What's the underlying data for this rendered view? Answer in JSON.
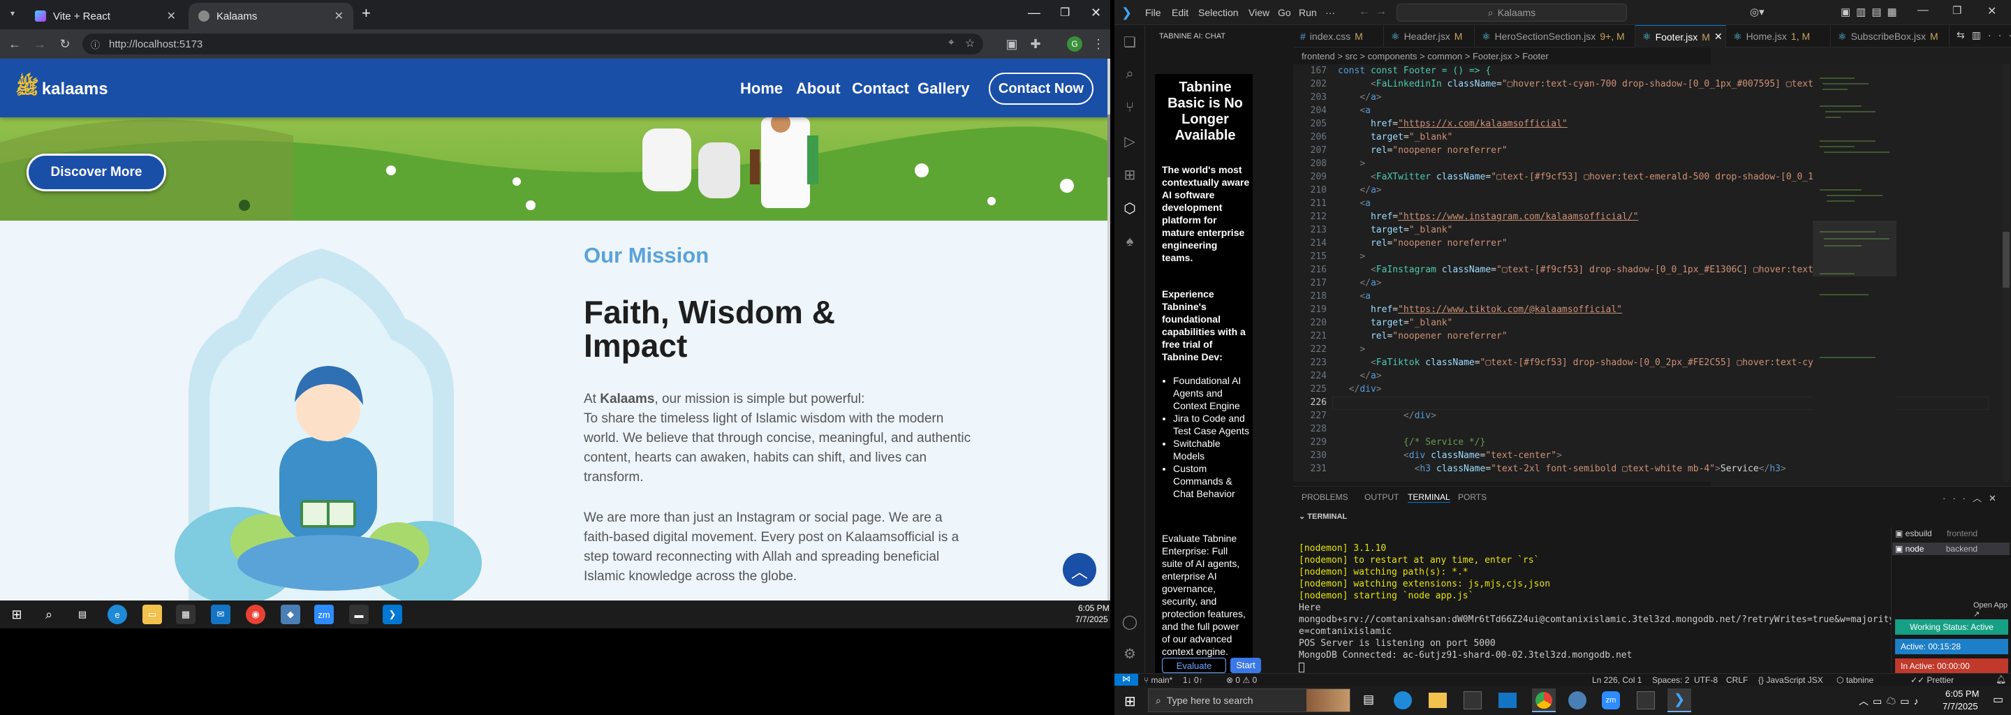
{
  "chrome": {
    "tabs": [
      {
        "label": "Vite + React"
      },
      {
        "label": "Kalaams"
      }
    ],
    "new_tab": "+",
    "url": "http://localhost:5173"
  },
  "site": {
    "logo": "kalaams",
    "nav": [
      {
        "label": "Home"
      },
      {
        "label": "About"
      },
      {
        "label": "Contact"
      },
      {
        "label": "Gallery"
      }
    ],
    "contact_button": "Contact Now",
    "discover_button": "Discover More",
    "mission_label": "Our Mission",
    "mission_title_line1": "Faith, Wisdom &",
    "mission_title_line2": "Impact",
    "p1_prefix": "At ",
    "p1_brand": "Kalaams",
    "p1_suffix": ", our mission is simple but powerful:",
    "p1_body": "To share the timeless light of Islamic wisdom with the modern world. We believe that through concise, meaningful, and authentic content, hearts can awaken, habits can shift, and lives can transform.",
    "p2": "We are more than just an Instagram or social page. We are a faith-based digital movement. Every post on Kalaamsofficial is a step toward reconnecting with Allah and spreading beneficial Islamic knowledge across the globe."
  },
  "left_taskbar": {
    "time": "6:05 PM",
    "date": "7/7/2025"
  },
  "vscode": {
    "menu": [
      "File",
      "Edit",
      "Selection",
      "View",
      "Go",
      "Run",
      "···"
    ],
    "search": "Kalaams",
    "tabnine_title": "TABNINE AI: CHAT",
    "tabnine": {
      "heading": "Tabnine Basic is No Longer Available",
      "p1": "The world's most contextually aware AI software development platform for mature enterprise engineering teams.",
      "p2": "Experience Tabnine's foundational capabilities with a free trial of Tabnine Dev:",
      "bullets": [
        "Foundational AI Agents and Context Engine",
        "Jira to Code and Test Case Agents",
        "Switchable Models",
        "Custom Commands & Chat Behavior"
      ],
      "p3": "Evaluate Tabnine Enterprise: Full suite of AI agents, enterprise AI governance, security, and protection features, and the full power of our advanced context engine.",
      "btn1": "Evaluate",
      "btn2": "Start"
    },
    "tabs": [
      {
        "label": "index.css",
        "mark": "M"
      },
      {
        "label": "Header.jsx",
        "mark": "M"
      },
      {
        "label": "HeroSectionSection.jsx",
        "mark": "9+, M"
      },
      {
        "label": "Footer.jsx",
        "mark": "M"
      },
      {
        "label": "Home.jsx",
        "mark": "1, M"
      },
      {
        "label": "SubscribeBox.jsx",
        "mark": "M"
      }
    ],
    "breadcrumb": "frontend > src > components > common > Footer.jsx > Footer",
    "sticky": "const Footer = () => {",
    "lines": [
      "167",
      "202",
      "203",
      "204",
      "205",
      "206",
      "207",
      "208",
      "209",
      "210",
      "211",
      "212",
      "213",
      "214",
      "215",
      "216",
      "217",
      "218",
      "219",
      "220",
      "221",
      "222",
      "223",
      "224",
      "225",
      "226",
      "227",
      "228",
      "229",
      "230",
      "231"
    ],
    "panel_tabs": [
      "PROBLEMS",
      "OUTPUT",
      "TERMINAL",
      "PORTS"
    ],
    "terminal_label": "TERMINAL",
    "terminal": [
      "[nodemon] 3.1.10",
      "[nodemon] to restart at any time, enter `rs`",
      "[nodemon] watching path(s): *.*",
      "[nodemon] watching extensions: js,mjs,cjs,json",
      "[nodemon] starting `node app.js`",
      "Here",
      "mongodb+srv://comtanixahsan:dW0Mr6tTd66Z24ui@comtanixislamic.3tel3zd.mongodb.net/?retryWrites=true&w=majority&appName",
      "e=comtanixislamic",
      "POS Server is listening on port 5000",
      "MongoDB Connected: ac-6utjz91-shard-00-02.3tel3zd.mongodb.net"
    ],
    "terminals": [
      {
        "label": "esbuild",
        "sub": "frontend"
      },
      {
        "label": "node",
        "sub": "backend"
      }
    ],
    "open_app": "Open App ↗",
    "working_status": "Working Status: Active",
    "active_time": "Active: 00:15:28",
    "inactive_time": "In Active: 00:00:00",
    "status_left": "main*",
    "status_sync": "1↓ 0↑",
    "status_problems": "⊗ 0 ⚠ 0",
    "status_right": [
      "Ln 226, Col 1",
      "Spaces: 2",
      "UTF-8",
      "CRLF",
      "{} JavaScript JSX",
      "tabnine",
      "Prettier"
    ]
  },
  "right_taskbar": {
    "search": "Type here to search",
    "time": "6:05 PM",
    "date": "7/7/2025"
  }
}
